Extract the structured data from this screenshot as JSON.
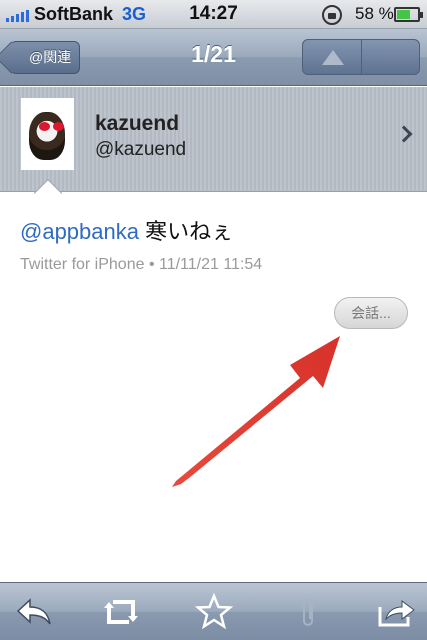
{
  "status_bar": {
    "carrier": "SoftBank",
    "network": "3G",
    "time": "14:27",
    "battery": "58 %"
  },
  "nav": {
    "back_label": "@関連",
    "title": "1/21"
  },
  "user": {
    "name": "kazuend",
    "handle": "@kazuend"
  },
  "tweet": {
    "mention": "@appbanka",
    "text": " 寒いねぇ",
    "meta": "Twitter for iPhone • 11/11/21 11:54"
  },
  "conversation_button": "会話...",
  "colors": {
    "mention": "#2f6bc4",
    "arrow": "#e0362c",
    "nav_bar": "#8b9bb0"
  },
  "toolbar": {
    "icons": [
      "reply-icon",
      "retweet-icon",
      "favorite-star-icon",
      "attachment-clip-icon",
      "share-icon"
    ]
  }
}
